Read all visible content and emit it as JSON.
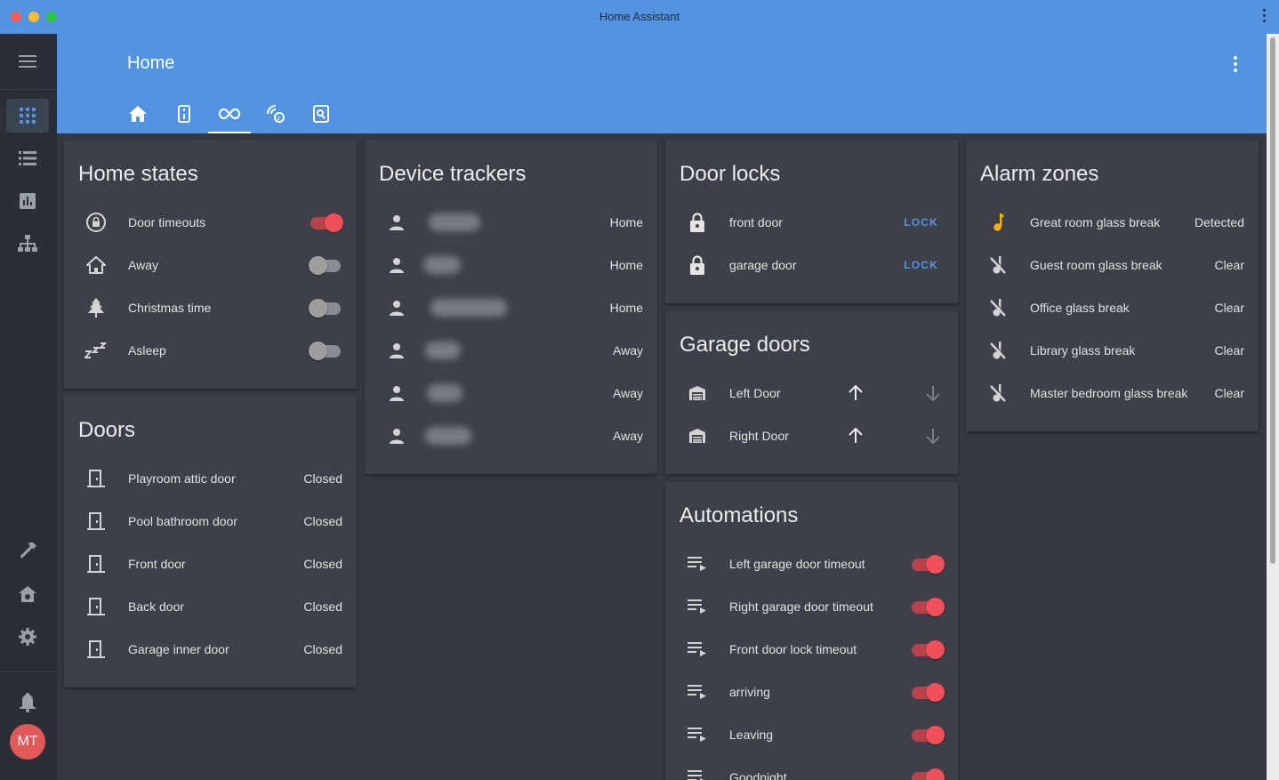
{
  "window": {
    "title": "Home Assistant"
  },
  "header": {
    "title": "Home"
  },
  "user": {
    "initials": "MT"
  },
  "colors": {
    "accent": "#5294e2",
    "toggle_on": "#f0505a",
    "detected": "#f4b400"
  },
  "cards": {
    "home_states": {
      "title": "Home states",
      "rows": [
        {
          "name": "Door timeouts",
          "on": true,
          "icon": "lock-timer-icon"
        },
        {
          "name": "Away",
          "on": false,
          "icon": "home-outline-icon"
        },
        {
          "name": "Christmas time",
          "on": false,
          "icon": "pine-tree-icon"
        },
        {
          "name": "Asleep",
          "on": false,
          "icon": "sleep-icon"
        }
      ]
    },
    "doors": {
      "title": "Doors",
      "rows": [
        {
          "name": "Playroom attic door",
          "state": "Closed"
        },
        {
          "name": "Pool bathroom door",
          "state": "Closed"
        },
        {
          "name": "Front door",
          "state": "Closed"
        },
        {
          "name": "Back door",
          "state": "Closed"
        },
        {
          "name": "Garage inner door",
          "state": "Closed"
        }
      ]
    },
    "device_trackers": {
      "title": "Device trackers",
      "rows": [
        {
          "state": "Home"
        },
        {
          "state": "Home"
        },
        {
          "state": "Home"
        },
        {
          "state": "Away"
        },
        {
          "state": "Away"
        },
        {
          "state": "Away"
        }
      ]
    },
    "door_locks": {
      "title": "Door locks",
      "rows": [
        {
          "name": "front door",
          "action": "LOCK"
        },
        {
          "name": "garage door",
          "action": "LOCK"
        }
      ]
    },
    "garage_doors": {
      "title": "Garage doors",
      "rows": [
        {
          "name": "Left Door"
        },
        {
          "name": "Right Door"
        }
      ]
    },
    "automations": {
      "title": "Automations",
      "rows": [
        {
          "name": "Left garage door timeout",
          "on": true
        },
        {
          "name": "Right garage door timeout",
          "on": true
        },
        {
          "name": "Front door lock timeout",
          "on": true
        },
        {
          "name": "arriving",
          "on": true
        },
        {
          "name": "Leaving",
          "on": true
        },
        {
          "name": "Goodnight",
          "on": true
        }
      ]
    },
    "alarm_zones": {
      "title": "Alarm zones",
      "rows": [
        {
          "name": "Great room glass break",
          "state": "Detected",
          "icon": "music-note-icon"
        },
        {
          "name": "Guest room glass break",
          "state": "Clear",
          "icon": "music-note-off-icon"
        },
        {
          "name": "Office glass break",
          "state": "Clear",
          "icon": "music-note-off-icon"
        },
        {
          "name": "Library glass break",
          "state": "Clear",
          "icon": "music-note-off-icon"
        },
        {
          "name": "Master bedroom glass break",
          "state": "Clear",
          "icon": "music-note-off-icon"
        }
      ]
    }
  }
}
